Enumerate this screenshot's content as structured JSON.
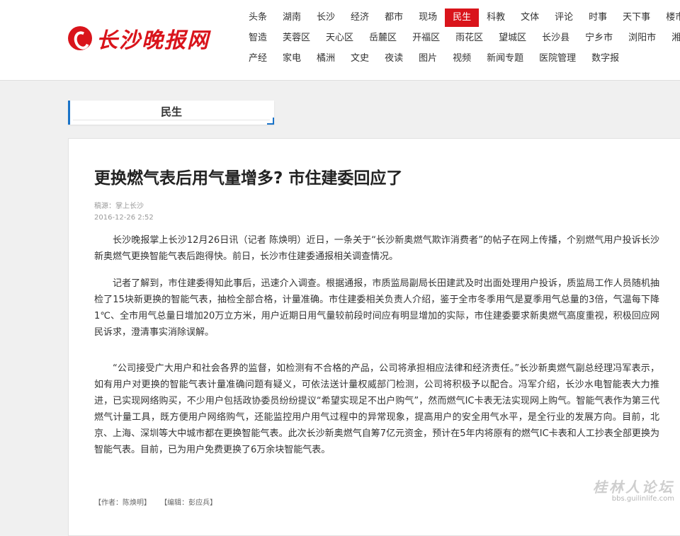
{
  "site": {
    "logo_text": "长沙晚报网"
  },
  "nav": {
    "row1": [
      "头条",
      "湖南",
      "长沙",
      "经济",
      "都市",
      "现场",
      "民生",
      "科教",
      "文体",
      "评论",
      "时事",
      "天下事",
      "楼市"
    ],
    "row2": [
      "智造",
      "芙蓉区",
      "天心区",
      "岳麓区",
      "开福区",
      "雨花区",
      "望城区",
      "长沙县",
      "宁乡市",
      "浏阳市",
      "湘"
    ],
    "row3": [
      "产经",
      "家电",
      "橘洲",
      "文史",
      "夜读",
      "图片",
      "视频",
      "新闻专题",
      "医院管理",
      "数字报"
    ],
    "active": "民生"
  },
  "section": {
    "label": "民生"
  },
  "article": {
    "title": "更换燃气表后用气量增多? 市住建委回应了",
    "source": "稿源：掌上长沙",
    "date": "2016-12-26 2:52",
    "paragraphs": [
      "长沙晚报掌上长沙12月26日讯（记者 陈焕明）近日，一条关于“长沙新奥燃气欺诈消费者”的帖子在网上传播，个别燃气用户投诉长沙新奥燃气更换智能气表后跑得快。前日，长沙市住建委通报相关调查情况。",
      "记者了解到，市住建委得知此事后，迅速介入调查。根据通报，市质监局副局长田建武及时出面处理用户投诉，质监局工作人员随机抽检了15块新更换的智能气表，抽检全部合格，计量准确。市住建委相关负责人介绍，鉴于全市冬季用气是夏季用气总量的3倍，气温每下降1℃、全市用气总量日增加20万立方米，用户近期日用气量较前段时间应有明显增加的实际，市住建委要求新奥燃气高度重视，积极回应网民诉求，澄清事实消除误解。",
      "“公司接受广大用户和社会各界的监督，如检测有不合格的产品，公司将承担相应法律和经济责任。”长沙新奥燃气副总经理冯军表示，如有用户对更换的智能气表计量准确问题有疑义，可依法送计量权威部门检测，公司将积极予以配合。冯军介绍，长沙水电智能表大力推进，已实现网络购买，不少用户包括政协委员纷纷提议“希望实现足不出户购气”，然而燃气IC卡表无法实现网上购气。智能气表作为第三代燃气计量工具，既方便用户网络购气，还能监控用户用气过程中的异常现象，提高用户的安全用气水平，是全行业的发展方向。目前，北京、上海、深圳等大中城市都在更换智能气表。此次长沙新奥燃气自筹7亿元资金，预计在5年内将原有的燃气IC卡表和人工抄表全部更换为智能气表。目前，已为用户免费更换了6万余块智能气表。"
    ],
    "author": "【作者：陈焕明】",
    "editor": "【编辑：彭应兵】"
  },
  "watermark": {
    "main": "桂林人论坛",
    "sub": "bbs.guilinlife.com"
  }
}
